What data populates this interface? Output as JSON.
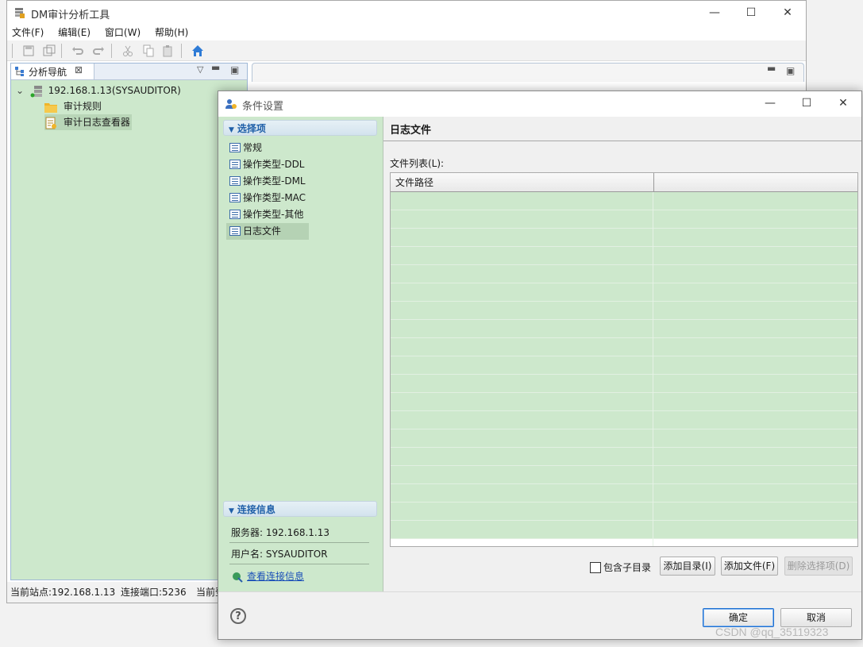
{
  "main_window": {
    "title": "DM审计分析工具",
    "menu": [
      "文件(F)",
      "编辑(E)",
      "窗口(W)",
      "帮助(H)"
    ],
    "nav_tab_label": "分析导航",
    "tree": {
      "server": "192.168.1.13(SYSAUDITOR)",
      "children": [
        "审计规则",
        "审计日志查看器"
      ]
    },
    "status": {
      "site": "当前站点:192.168.1.13",
      "port": "连接端口:5236",
      "extra": "当前登"
    }
  },
  "dialog": {
    "title": "条件设置",
    "options_header": "选择项",
    "options": [
      "常规",
      "操作类型-DDL",
      "操作类型-DML",
      "操作类型-MAC",
      "操作类型-其他",
      "日志文件"
    ],
    "selected_option": "日志文件",
    "conn_header": "连接信息",
    "server_info": "服务器: 192.168.1.13",
    "user_info": "用户名: SYSAUDITOR",
    "view_conn_link": "查看连接信息",
    "page_title": "日志文件",
    "file_list_label": "文件列表(L):",
    "table": {
      "columns": [
        "文件路径",
        ""
      ],
      "rows": []
    },
    "include_subdir_label": "包含子目录",
    "include_subdir_checked": false,
    "add_dir_button": "添加目录(I)",
    "add_file_button": "添加文件(F)",
    "delete_button": "删除选择项(D)",
    "ok_button": "确定",
    "cancel_button": "取消"
  },
  "watermark": "CSDN @qq_35119323",
  "colors": {
    "panel_green": "#cde8cc",
    "section_text": "#1f5fa8",
    "link_blue": "#1a4fb8"
  }
}
